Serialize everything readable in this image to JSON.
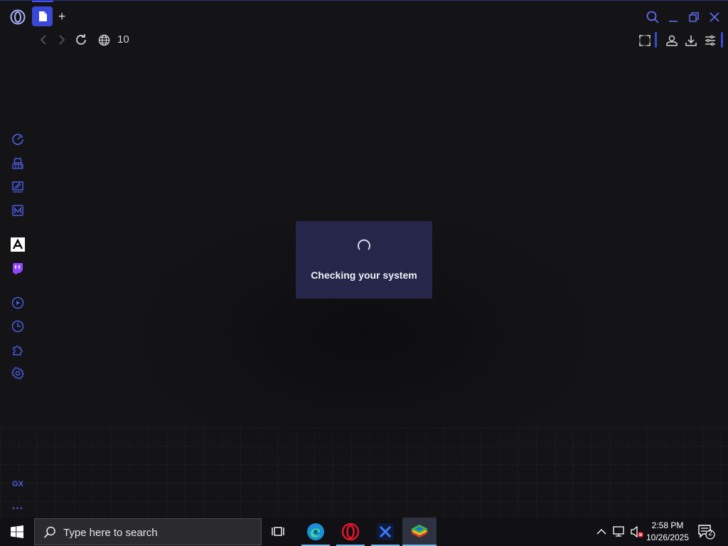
{
  "browser": {
    "address_text": "10",
    "new_tab_label": "+",
    "sidebar": {
      "items": [
        {
          "name": "gx-control-icon"
        },
        {
          "name": "gx-cleaner-icon"
        },
        {
          "name": "gx-corner-icon"
        },
        {
          "name": "mail-icon"
        },
        {
          "name": "aria-icon"
        },
        {
          "name": "twitch-icon"
        },
        {
          "name": "player-icon"
        },
        {
          "name": "history-icon"
        },
        {
          "name": "extensions-icon"
        },
        {
          "name": "settings-icon"
        }
      ],
      "gx_label": "GX",
      "more_label": "..."
    }
  },
  "dialog": {
    "message": "Checking your system"
  },
  "taskbar": {
    "search_placeholder": "Type here to search",
    "apps": [
      "task-view-icon",
      "edge-icon",
      "opera-icon",
      "x-app-icon",
      "bluestacks-icon"
    ],
    "clock_time": "2:58 PM",
    "clock_date": "10/26/2025",
    "notification_count": "2"
  },
  "colors": {
    "accent": "#3a48d6",
    "sidebar_icon": "#4b5be0",
    "twitch": "#9146ff",
    "dialog_bg": "#26264a"
  }
}
